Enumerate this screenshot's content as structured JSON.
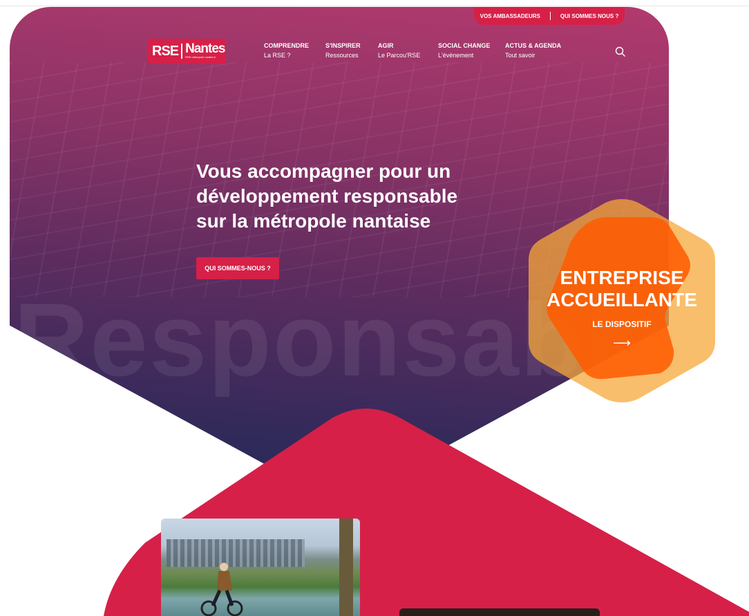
{
  "top_links": {
    "ambassadeurs": "VOS AMBASSADEURS",
    "qui": "QUI SOMMES NOUS ?"
  },
  "logo": {
    "rse": "RSE",
    "nantes": "Nantes",
    "sub": "RSE.metropole.nantes.fr"
  },
  "nav": [
    {
      "title": "COMPRENDRE",
      "sub": "La RSE ?"
    },
    {
      "title": "S'INSPIRER",
      "sub": "Ressources"
    },
    {
      "title": "AGIR",
      "sub": "Le Parcou'RSE"
    },
    {
      "title": "SOCIAL CHANGE",
      "sub": "L'évènement"
    },
    {
      "title": "ACTUS & AGENDA",
      "sub": "Tout savoir"
    }
  ],
  "hero": {
    "headline_lines": [
      "Vous accompagner pour un",
      "développement responsable",
      "sur la métropole nantaise"
    ],
    "cta": "QUI SOMMES-NOUS ?",
    "watermark": "Responsable"
  },
  "badge": {
    "line1": "ENTREPRISE",
    "line2": "ACCUEILLANTE",
    "link": "LE DISPOSITIF",
    "arrow": "⟶"
  },
  "icons": {
    "search": "search-icon",
    "arrow": "arrow-right-icon"
  },
  "colors": {
    "brand_red": "#d62048",
    "orange": "#f7941d",
    "hero_top": "#b23a6e",
    "hero_bottom": "#262654"
  }
}
